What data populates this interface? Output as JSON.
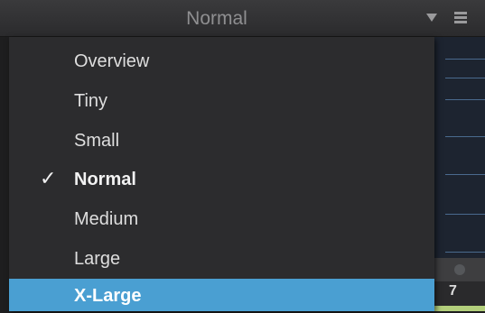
{
  "header": {
    "title": "Normal"
  },
  "menu": {
    "items": [
      {
        "label": "Overview"
      },
      {
        "label": "Tiny"
      },
      {
        "label": "Small"
      },
      {
        "label": "Normal",
        "checked": true
      },
      {
        "label": "Medium"
      },
      {
        "label": "Large"
      },
      {
        "label": "X-Large",
        "highlighted": true
      }
    ],
    "checkmark": "✓"
  },
  "side_panel": {
    "value": "7"
  },
  "colors": {
    "highlight": "#4a9fd2",
    "menu_background": "#2c2c2e",
    "header_background": "#333335"
  }
}
